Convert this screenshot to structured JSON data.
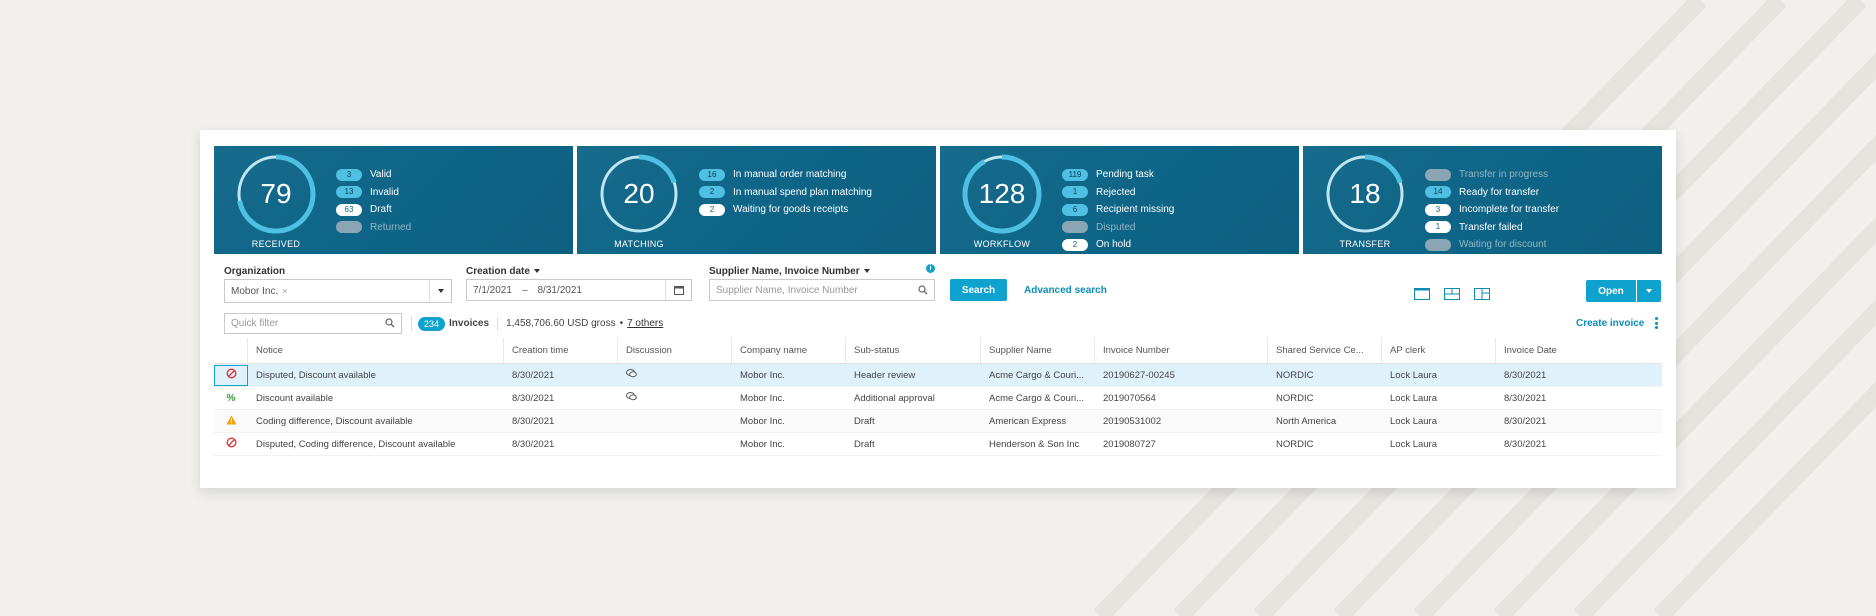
{
  "tiles": [
    {
      "value": "79",
      "label": "RECEIVED",
      "progress": 0.72,
      "stats": [
        {
          "count": "3",
          "text": "Valid",
          "style": "blue"
        },
        {
          "count": "13",
          "text": "Invalid",
          "style": "blue"
        },
        {
          "count": "63",
          "text": "Draft",
          "style": "white"
        },
        {
          "count": "0",
          "text": "Returned",
          "style": "grey"
        }
      ]
    },
    {
      "value": "20",
      "label": "MATCHING",
      "progress": 0.2,
      "stats": [
        {
          "count": "16",
          "text": "In manual order matching",
          "style": "blue"
        },
        {
          "count": "2",
          "text": "In manual spend plan matching",
          "style": "blue"
        },
        {
          "count": "2",
          "text": "Waiting for goods receipts",
          "style": "white"
        }
      ]
    },
    {
      "value": "128",
      "label": "WORKFLOW",
      "progress": 0.92,
      "stats": [
        {
          "count": "119",
          "text": "Pending task",
          "style": "blue"
        },
        {
          "count": "1",
          "text": "Rejected",
          "style": "blue"
        },
        {
          "count": "6",
          "text": "Recipient missing",
          "style": "blue"
        },
        {
          "count": "0",
          "text": "Disputed",
          "style": "grey"
        },
        {
          "count": "2",
          "text": "On hold",
          "style": "white"
        }
      ]
    },
    {
      "value": "18",
      "label": "TRANSFER",
      "progress": 0.2,
      "stats": [
        {
          "count": "0",
          "text": "Transfer in progress",
          "style": "grey"
        },
        {
          "count": "14",
          "text": "Ready for transfer",
          "style": "blue"
        },
        {
          "count": "3",
          "text": "Incomplete for transfer",
          "style": "white"
        },
        {
          "count": "1",
          "text": "Transfer failed",
          "style": "white"
        },
        {
          "count": "0",
          "text": "Waiting for discount",
          "style": "grey"
        }
      ]
    }
  ],
  "filters": {
    "organization_label": "Organization",
    "organization_value": "Mobor Inc.",
    "creation_date_label": "Creation date",
    "date_from": "7/1/2021",
    "date_sep": "–",
    "date_to": "8/31/2021",
    "supplier_label": "Supplier Name, Invoice Number",
    "supplier_placeholder": "Supplier Name, Invoice Number",
    "search_label": "Search",
    "advanced_search_label": "Advanced search",
    "quick_filter_placeholder": "Quick filter",
    "open_label": "Open",
    "create_invoice_label": "Create invoice"
  },
  "summary": {
    "count": "234",
    "invoices_label": "Invoices",
    "gross": "1,458,706.60 USD gross",
    "bullet": "•",
    "others": "7 others"
  },
  "table": {
    "headers": [
      "Notice",
      "Creation time",
      "Discussion",
      "Company name",
      "Sub-status",
      "Supplier Name",
      "Invoice Number",
      "Shared Service Ce...",
      "AP clerk",
      "Invoice Date"
    ],
    "rows": [
      {
        "icon": "disputed-icon",
        "notice": "Disputed, Discount available",
        "created": "8/30/2021",
        "discussion": true,
        "company": "Mobor Inc.",
        "substatus": "Header review",
        "supplier": "Acme Cargo & Couri...",
        "number": "20190627-00245",
        "ssc": "NORDIC",
        "clerk": "Lock Laura",
        "date": "8/30/2021"
      },
      {
        "icon": "discount-icon",
        "notice": "Discount available",
        "created": "8/30/2021",
        "discussion": true,
        "company": "Mobor Inc.",
        "substatus": "Additional approval",
        "supplier": "Acme Cargo & Couri...",
        "number": "2019070564",
        "ssc": "NORDIC",
        "clerk": "Lock Laura",
        "date": "8/30/2021"
      },
      {
        "icon": "warning-icon",
        "notice": "Coding difference, Discount available",
        "created": "8/30/2021",
        "discussion": false,
        "company": "Mobor Inc.",
        "substatus": "Draft",
        "supplier": "American Express",
        "number": "20190531002",
        "ssc": "North America",
        "clerk": "Lock Laura",
        "date": "8/30/2021"
      },
      {
        "icon": "disputed-icon",
        "notice": "Disputed, Coding difference, Discount available",
        "created": "8/30/2021",
        "discussion": false,
        "company": "Mobor Inc.",
        "substatus": "Draft",
        "supplier": "Henderson & Son Inc",
        "number": "2019080727",
        "ssc": "NORDIC",
        "clerk": "Lock Laura",
        "date": "8/30/2021"
      }
    ]
  },
  "colors": {
    "tile_bg": "#0e6587",
    "accent": "#0fa2cf",
    "gauge_ring": "#4fc0e2",
    "disputed": "#e23a3a",
    "discount": "#2f9e3a",
    "warning": "#f0a30a"
  }
}
